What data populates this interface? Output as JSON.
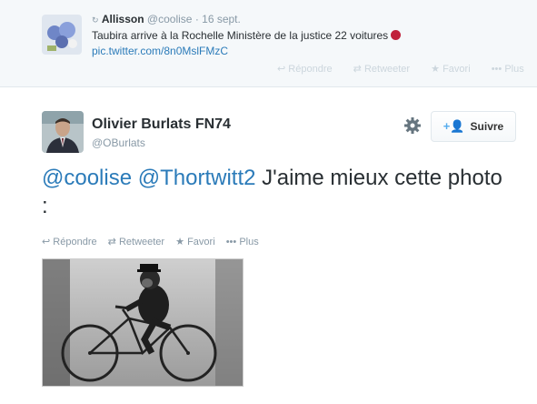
{
  "reply_tweet": {
    "name": "Allisson",
    "handle": "@coolise",
    "separator": "·",
    "time": "16 sept.",
    "text": "Taubira arrive à la Rochelle Ministère de la justice 22 voitures",
    "link": "pic.twitter.com/8n0MslFMzC",
    "actions": {
      "reply": "Répondre",
      "retweet": "Retweeter",
      "favorite": "Favori",
      "more": "Plus"
    }
  },
  "main_tweet": {
    "author_name": "Olivier Burlats FN74",
    "author_handle": "@OBurlats",
    "follow_label": "Suivre",
    "text_mention1": "@coolise",
    "text_mention2": "@Thortwitt2",
    "text_body": " J'aime mieux cette photo :",
    "actions": {
      "reply": "Répondre",
      "retweet": "Retweeter",
      "favorite": "Favori",
      "more": "Plus"
    }
  },
  "colors": {
    "link": "#2b7bb9",
    "muted": "#8899a6",
    "follow_accent": "#55acee"
  }
}
